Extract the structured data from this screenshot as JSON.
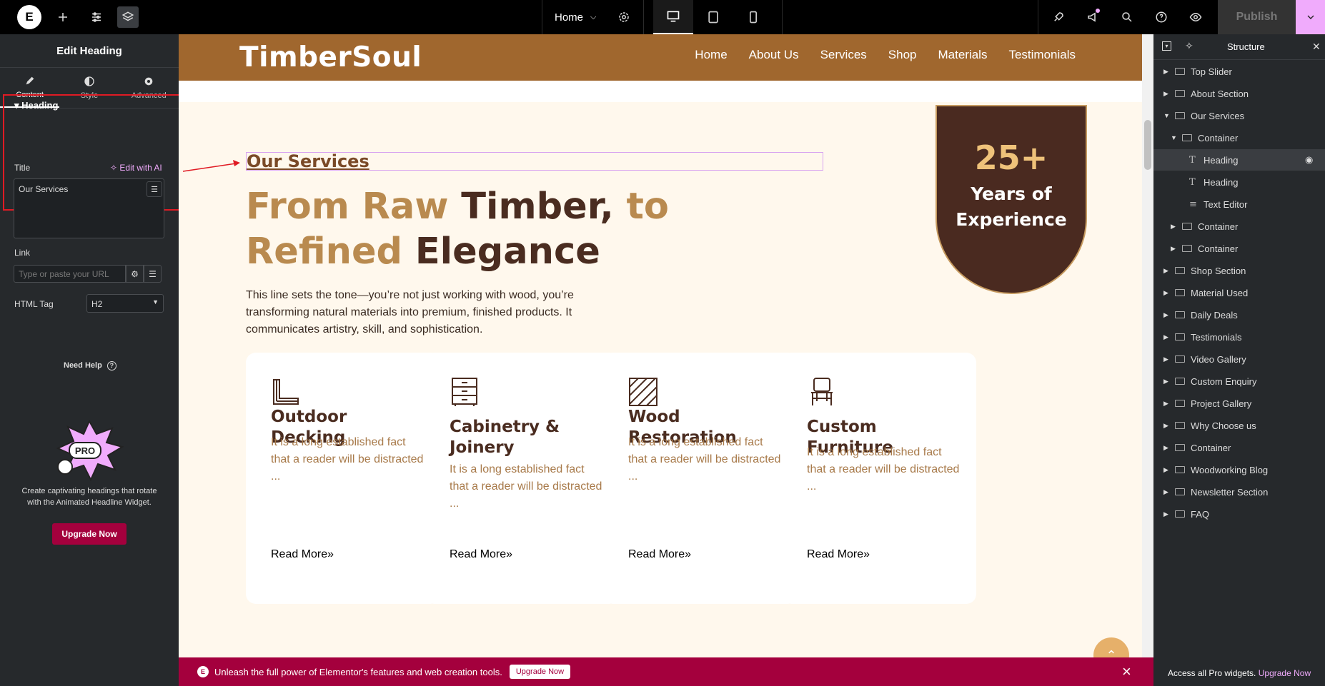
{
  "topbar": {
    "logo": "E",
    "page": "Home",
    "publish": "Publish"
  },
  "left_panel": {
    "title": "Edit Heading",
    "tabs": [
      {
        "label": "Content",
        "icon": "pencil-icon"
      },
      {
        "label": "Style",
        "icon": "half-circle-icon"
      },
      {
        "label": "Advanced",
        "icon": "gear-icon"
      }
    ],
    "section_title": "Heading",
    "title_label": "Title",
    "edit_ai": "Edit with AI",
    "title_value": "Our Services",
    "link_label": "Link",
    "link_placeholder": "Type or paste your URL",
    "html_tag_label": "HTML Tag",
    "html_tag_value": "H2",
    "need_help": "Need Help",
    "promo_badge": "PRO",
    "promo_text": "Create captivating headings that rotate with the Animated Headline Widget.",
    "upgrade": "Upgrade Now"
  },
  "site": {
    "brand": "TimberSoul",
    "nav": [
      "Home",
      "About Us",
      "Services",
      "Shop",
      "Materials",
      "Testimonials"
    ],
    "kicker": "Our Services",
    "title_parts": {
      "p1": "From Raw ",
      "p2": "Timber,",
      "p3": " to ",
      "p4": "Refined ",
      "p5": "Elegance"
    },
    "description": "This line sets the tone—you’re not just working with wood, you’re transforming natural materials into premium, finished products. It communicates artistry, skill, and sophistication.",
    "badge": {
      "number": "25+",
      "line1": "Years of",
      "line2": "Experience"
    },
    "cards": [
      {
        "title": "Outdoor Decking",
        "text": "It is a long established fact that a reader will be distracted ...",
        "button": "Read More",
        "icon": "decking-icon"
      },
      {
        "title": "Cabinetry & Joinery",
        "text": "It is a long established fact that a reader will be distracted ...",
        "button": "Read More",
        "icon": "cabinet-icon"
      },
      {
        "title": "Wood Restoration",
        "text": "It is a long established fact that a reader will be distracted ...",
        "button": "Read More",
        "icon": "wood-texture-icon"
      },
      {
        "title": "Custom Furniture",
        "text": "It is a long established fact that a reader will be distracted ...",
        "button": "Read More",
        "icon": "chair-icon"
      }
    ]
  },
  "structure": {
    "title": "Structure",
    "items": [
      {
        "label": "Top Slider",
        "level": 0,
        "type": "container",
        "arrow": "right"
      },
      {
        "label": "About Section",
        "level": 0,
        "type": "container",
        "arrow": "right"
      },
      {
        "label": "Our Services",
        "level": 0,
        "type": "container",
        "arrow": "down"
      },
      {
        "label": "Container",
        "level": 1,
        "type": "container",
        "arrow": "down"
      },
      {
        "label": "Heading",
        "level": 2,
        "type": "heading",
        "arrow": "",
        "selected": true
      },
      {
        "label": "Heading",
        "level": 2,
        "type": "heading",
        "arrow": ""
      },
      {
        "label": "Text Editor",
        "level": 2,
        "type": "text",
        "arrow": ""
      },
      {
        "label": "Container",
        "level": 1,
        "type": "container",
        "arrow": "right"
      },
      {
        "label": "Container",
        "level": 1,
        "type": "container",
        "arrow": "right"
      },
      {
        "label": "Shop Section",
        "level": 0,
        "type": "container",
        "arrow": "right"
      },
      {
        "label": "Material Used",
        "level": 0,
        "type": "container",
        "arrow": "right"
      },
      {
        "label": "Daily Deals",
        "level": 0,
        "type": "container",
        "arrow": "right"
      },
      {
        "label": "Testimonials",
        "level": 0,
        "type": "container",
        "arrow": "right"
      },
      {
        "label": "Video Gallery",
        "level": 0,
        "type": "container",
        "arrow": "right"
      },
      {
        "label": "Custom Enquiry",
        "level": 0,
        "type": "container",
        "arrow": "right"
      },
      {
        "label": "Project Gallery",
        "level": 0,
        "type": "container",
        "arrow": "right"
      },
      {
        "label": "Why Choose us",
        "level": 0,
        "type": "container",
        "arrow": "right"
      },
      {
        "label": "Container",
        "level": 0,
        "type": "container",
        "arrow": "right"
      },
      {
        "label": "Woodworking Blog",
        "level": 0,
        "type": "container",
        "arrow": "right"
      },
      {
        "label": "Newsletter Section",
        "level": 0,
        "type": "container",
        "arrow": "right"
      },
      {
        "label": "FAQ",
        "level": 0,
        "type": "container",
        "arrow": "right"
      }
    ],
    "footer_text": "Access all Pro widgets.",
    "footer_link": "Upgrade Now"
  },
  "notice": {
    "text": "Unleash the full power of Elementor's features and web creation tools.",
    "button": "Upgrade Now"
  },
  "colors": {
    "header_brown": "#a0672e",
    "accent_gold": "#b98a4f",
    "dark_brown": "#4a2c20",
    "elementor_red": "#a4003d",
    "pro_pink": "#f0abfc"
  }
}
